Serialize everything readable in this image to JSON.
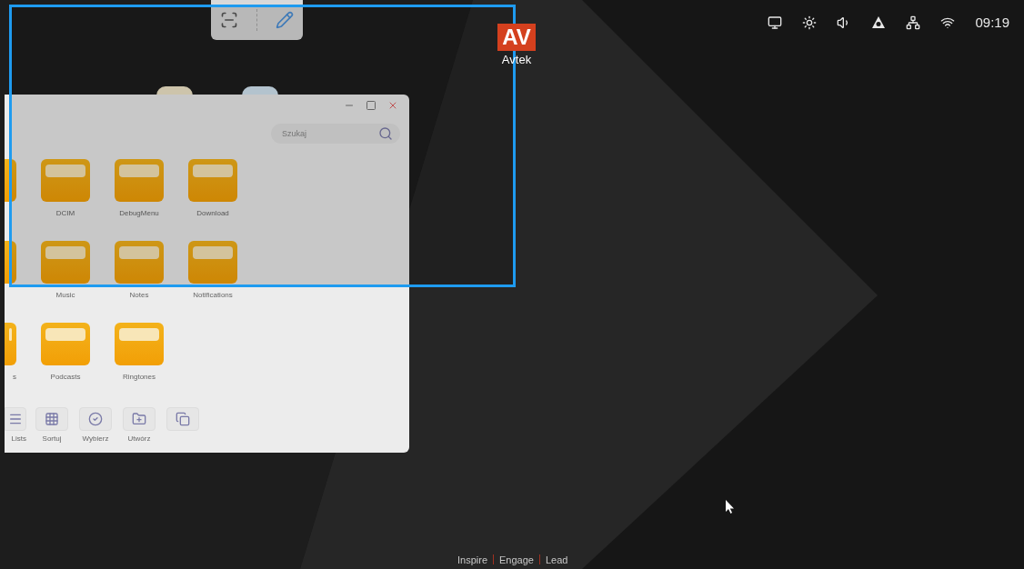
{
  "capture_toolbar": {
    "tools": [
      {
        "kind": "screenshot",
        "selected": false
      },
      {
        "kind": "pen",
        "selected": true
      }
    ]
  },
  "desktop_icon": {
    "logo_text": "AV",
    "label": "Avtek"
  },
  "status_bar": {
    "time": "09:19"
  },
  "file_manager": {
    "search": {
      "placeholder": "Szukaj"
    },
    "folder_rows": [
      [
        {
          "partial": true
        },
        {
          "label": "DCIM",
          "partial": false
        },
        {
          "label": "DebugMenu",
          "partial": false
        },
        {
          "label": "Download",
          "partial": false
        }
      ],
      [
        {
          "partial": true
        },
        {
          "label": "Music",
          "partial": false
        },
        {
          "label": "Notes",
          "partial": false
        },
        {
          "label": "Notifications",
          "partial": false
        }
      ],
      [
        {
          "label": "s",
          "partial": true
        },
        {
          "label": "Podcasts",
          "partial": false
        },
        {
          "label": "Ringtones",
          "partial": false
        }
      ]
    ],
    "actions": [
      {
        "kind": "list",
        "label": "Lists",
        "partial": true
      },
      {
        "kind": "sort",
        "label": "Sortuj",
        "partial": false
      },
      {
        "kind": "select",
        "label": "Wybierz",
        "partial": false
      },
      {
        "kind": "create",
        "label": "Utwórz",
        "partial": false
      },
      {
        "kind": "copy",
        "partial": false
      }
    ]
  },
  "tagline": [
    "Inspire",
    "Engage",
    "Lead"
  ]
}
